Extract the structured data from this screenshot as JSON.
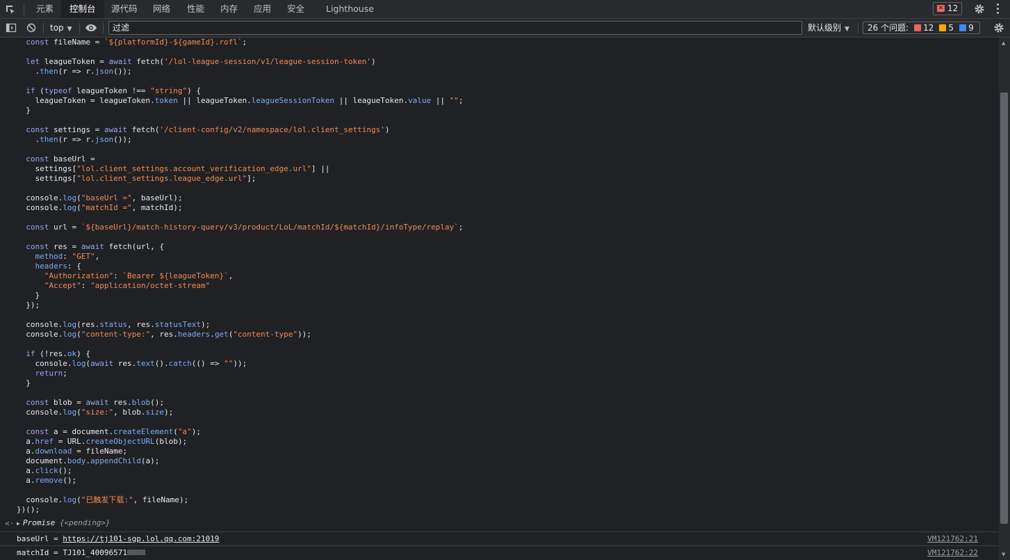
{
  "tabs": [
    {
      "label": "元素"
    },
    {
      "label": "控制台"
    },
    {
      "label": "源代码"
    },
    {
      "label": "网络"
    },
    {
      "label": "性能"
    },
    {
      "label": "内存"
    },
    {
      "label": "应用"
    },
    {
      "label": "安全"
    },
    {
      "label": "Lighthouse"
    }
  ],
  "active_tab": "控制台",
  "error_badge_count": "12",
  "toolbar": {
    "context": "top",
    "filter_placeholder": "过滤",
    "levels": "默认级别",
    "issues_label": "26 个问题:",
    "issues_errors": "12",
    "issues_warnings": "5",
    "issues_info": "9"
  },
  "console": {
    "code_lines": [
      "  const fileName = `${platformId}-${gameId}.rofl`;",
      "",
      "  let leagueToken = await fetch('/lol-league-session/v1/league-session-token')",
      "    .then(r => r.json());",
      "",
      "  if (typeof leagueToken !== \"string\") {",
      "    leagueToken = leagueToken.token || leagueToken.leagueSessionToken || leagueToken.value || \"\";",
      "  }",
      "",
      "  const settings = await fetch('/client-config/v2/namespace/lol.client_settings')",
      "    .then(r => r.json());",
      "",
      "  const baseUrl =",
      "    settings[\"lol.client_settings.account_verification_edge.url\"] ||",
      "    settings[\"lol.client_settings.league_edge.url\"];",
      "",
      "  console.log(\"baseUrl =\", baseUrl);",
      "  console.log(\"matchId =\", matchId);",
      "",
      "  const url = `${baseUrl}/match-history-query/v3/product/LoL/matchId/${matchId}/infoType/replay`;",
      "",
      "  const res = await fetch(url, {",
      "    method: \"GET\",",
      "    headers: {",
      "      \"Authorization\": `Bearer ${leagueToken}`,",
      "      \"Accept\": \"application/octet-stream\"",
      "    }",
      "  });",
      "",
      "  console.log(res.status, res.statusText);",
      "  console.log(\"content-type:\", res.headers.get(\"content-type\"));",
      "",
      "  if (!res.ok) {",
      "    console.log(await res.text().catch(() => \"\"));",
      "    return;",
      "  }",
      "",
      "  const blob = await res.blob();",
      "  console.log(\"size:\", blob.size);",
      "",
      "  const a = document.createElement(\"a\");",
      "  a.href = URL.createObjectURL(blob);",
      "  a.download = fileName;",
      "  document.body.appendChild(a);",
      "  a.click();",
      "  a.remove();",
      "",
      "  console.log(\"已触发下载:\", fileName);",
      "})();"
    ],
    "result": {
      "label": "Promise",
      "value": "{<pending>}"
    },
    "log_rows": [
      {
        "prefix": "baseUrl = ",
        "link": "https://tj101-sgp.lol.qq.com:21019",
        "source": "VM121762:21"
      },
      {
        "prefix": "matchId = ",
        "text": "TJ101_40096571",
        "source": "VM121762:22"
      }
    ]
  },
  "icons": [
    "inspect-icon",
    "dock-sidebar-icon",
    "clear-console-icon",
    "eye-icon",
    "settings-gear-icon",
    "more-vertical-icon"
  ]
}
